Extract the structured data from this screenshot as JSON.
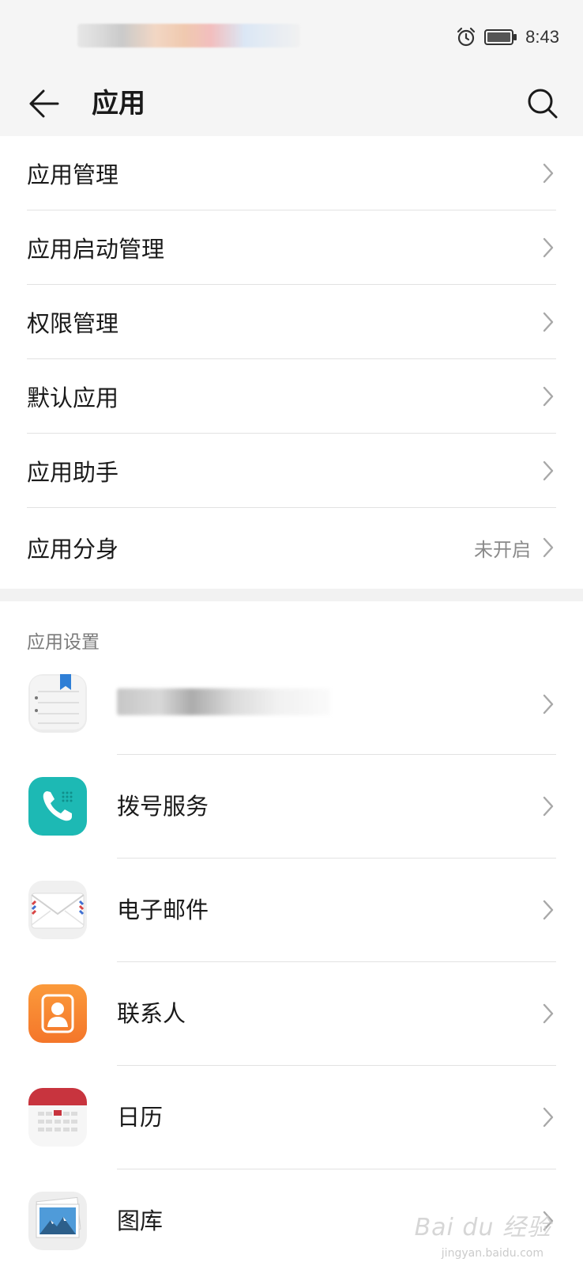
{
  "status_bar": {
    "time": "8:43"
  },
  "toolbar": {
    "title": "应用",
    "back_icon": "arrow-left-icon",
    "search_icon": "search-icon"
  },
  "menu": [
    {
      "label": "应用管理",
      "value": ""
    },
    {
      "label": "应用启动管理",
      "value": ""
    },
    {
      "label": "权限管理",
      "value": ""
    },
    {
      "label": "默认应用",
      "value": ""
    },
    {
      "label": "应用助手",
      "value": ""
    },
    {
      "label": "应用分身",
      "value": "未开启"
    }
  ],
  "section": {
    "header": "应用设置"
  },
  "apps": [
    {
      "label": "",
      "icon": "notes-app-icon"
    },
    {
      "label": "拨号服务",
      "icon": "phone-app-icon",
      "color": "#1db9b4"
    },
    {
      "label": "电子邮件",
      "icon": "email-app-icon"
    },
    {
      "label": "联系人",
      "icon": "contacts-app-icon",
      "color": "#f7872a"
    },
    {
      "label": "日历",
      "icon": "calendar-app-icon",
      "color": "#c8343e"
    },
    {
      "label": "图库",
      "icon": "gallery-app-icon"
    }
  ],
  "watermark": {
    "text": "Bai du 经验",
    "sub": "jingyan.baidu.com"
  }
}
